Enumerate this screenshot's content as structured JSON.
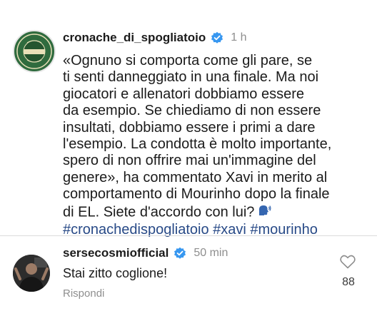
{
  "post": {
    "username": "cronache_di_spogliatoio",
    "time": "1 h",
    "avatar_text": "CRONACHE DI SPOGLIATOIO",
    "caption_lines": [
      "«Ognuno si comporta come gli pare, se",
      "ti senti danneggiato in una finale. Ma noi",
      "giocatori e allenatori dobbiamo essere",
      "da esempio. Se chiediamo di non essere",
      "insultati, dobbiamo essere i primi a dare",
      "l'esempio. La condotta è molto importante,",
      "spero di non offrire mai un'immagine del",
      "genere», ha commentato Xavi in merito al",
      "comportamento di Mourinho dopo la finale",
      "di EL. Siete d'accordo con lui?"
    ],
    "hashtags": "#cronachedispogliatoio #xavi #mourinho",
    "emoji_icon": "speaking-head-icon"
  },
  "comment": {
    "username": "sersecosmiofficial",
    "time": "50 min",
    "text": "Stai zitto coglione!",
    "reply_label": "Rispondi",
    "like_count": "88"
  },
  "colors": {
    "verified": "#3797f0",
    "hashtag": "#284a87",
    "muted": "#8e8e8e",
    "avatar_green": "#2f6b3e"
  }
}
